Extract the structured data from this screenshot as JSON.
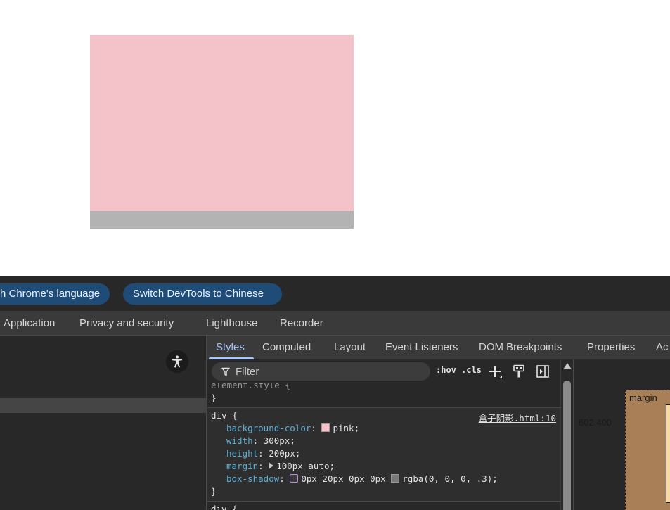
{
  "infobar": {
    "pill_1": "h Chrome's language",
    "pill_2": "Switch DevTools to Chinese"
  },
  "main_tabs": [
    "Application",
    "Privacy and security",
    "Lighthouse",
    "Recorder"
  ],
  "sub_tabs": [
    "Styles",
    "Computed",
    "Layout",
    "Event Listeners",
    "DOM Breakpoints",
    "Properties",
    "Ac"
  ],
  "toolbar": {
    "filter_placeholder": "Filter",
    "hov": ":hov",
    "cls": ".cls"
  },
  "rules": {
    "element_style": {
      "selector": "element.style {",
      "close": "}"
    },
    "div_rule": {
      "selector": "div {",
      "source": "盒子阴影.html:10",
      "properties": [
        {
          "name": "background-color",
          "value": "pink"
        },
        {
          "name": "width",
          "value": "300px"
        },
        {
          "name": "height",
          "value": "200px"
        },
        {
          "name": "margin",
          "value": "100px auto"
        },
        {
          "name": "box-shadow",
          "value": "0px 20px 0px 0px",
          "value2": "rgba(0, 0, 0, .3)"
        }
      ],
      "close": "}"
    },
    "next_rule_selector": "div {"
  },
  "box_model": {
    "label": "margin",
    "left_value": "602.400"
  },
  "colors": {
    "demo_box": "#f4c3ca",
    "demo_shadow": "#b3b3b3",
    "accent": "#a8c7fa",
    "pill_bg": "#1f4b77",
    "css_property": "#5db0d7"
  }
}
